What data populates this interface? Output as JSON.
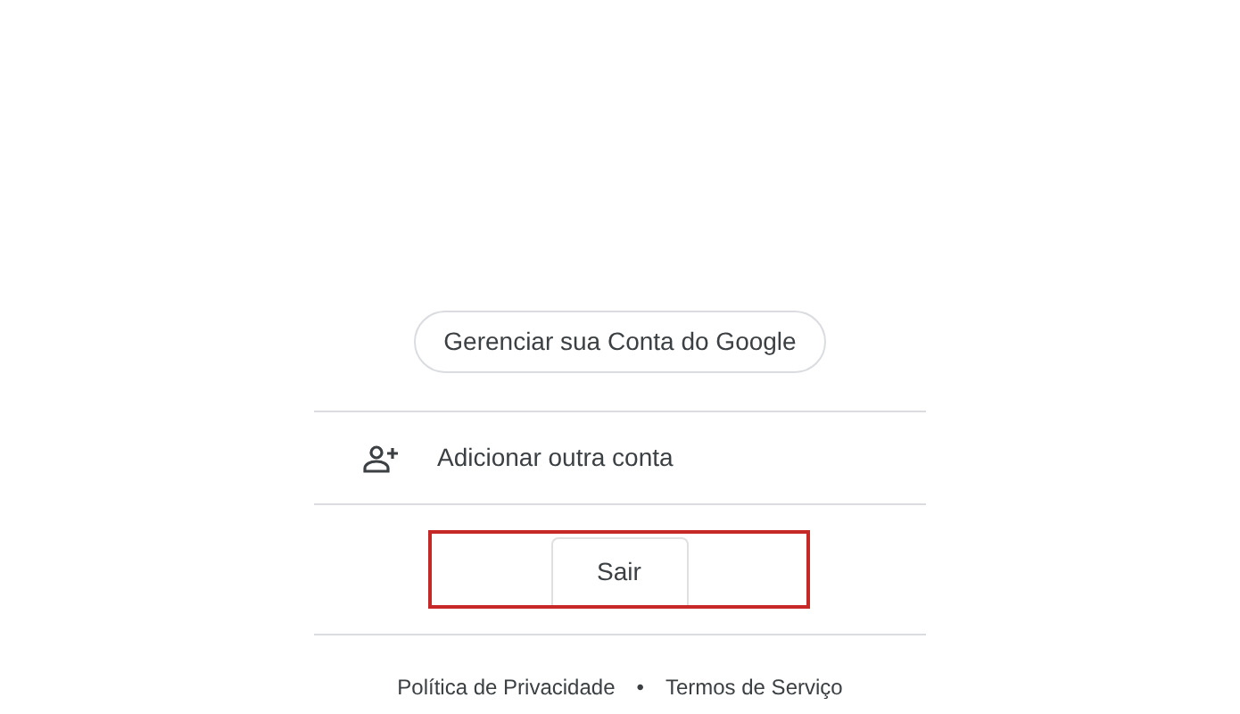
{
  "manage_account_button": "Gerenciar sua Conta do Google",
  "add_account": {
    "label": "Adicionar outra conta"
  },
  "sign_out": {
    "label": "Sair",
    "highlighted": true
  },
  "footer": {
    "links": [
      "Política de Privacidade",
      "Termos de Serviço"
    ],
    "separator": "•"
  }
}
